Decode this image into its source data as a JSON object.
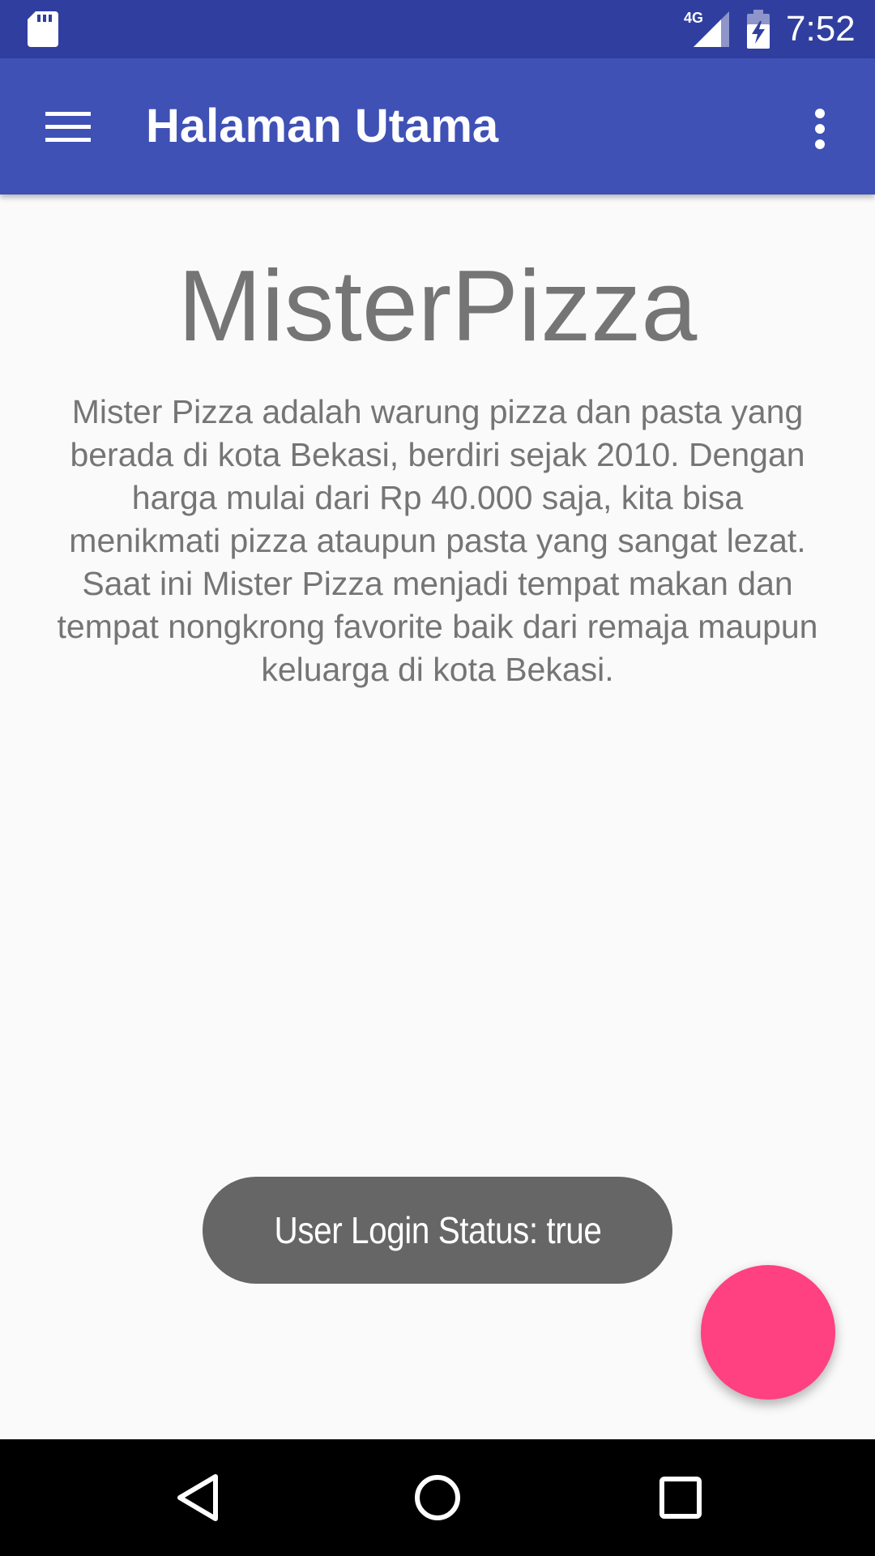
{
  "status_bar": {
    "time": "7:52",
    "network": "4G",
    "icons": [
      "sd-card-icon",
      "signal-icon",
      "battery-charging-icon"
    ]
  },
  "app_bar": {
    "title": "Halaman Utama",
    "menu_icon": "hamburger-menu-icon",
    "overflow_icon": "more-vert-icon",
    "color": "#3f51b5"
  },
  "content": {
    "brand_title": "MisterPizza",
    "description": "Mister Pizza adalah warung pizza dan pasta yang berada di kota Bekasi, berdiri sejak 2010. Dengan harga mulai dari Rp 40.000 saja, kita bisa menikmati pizza ataupun pasta yang sangat lezat. Saat ini Mister Pizza menjadi tempat makan dan tempat nongkrong favorite baik dari remaja maupun keluarga di kota Bekasi."
  },
  "toast": {
    "message": "User Login Status: true"
  },
  "fab": {
    "color": "#ff4081"
  },
  "nav_bar": {
    "icons": [
      "back-icon",
      "home-icon",
      "recents-icon"
    ]
  },
  "colors": {
    "status_bar": "#303f9f",
    "app_bar": "#3f51b5",
    "accent": "#ff4081",
    "text_secondary": "#757575",
    "toast_bg": "#666666"
  }
}
